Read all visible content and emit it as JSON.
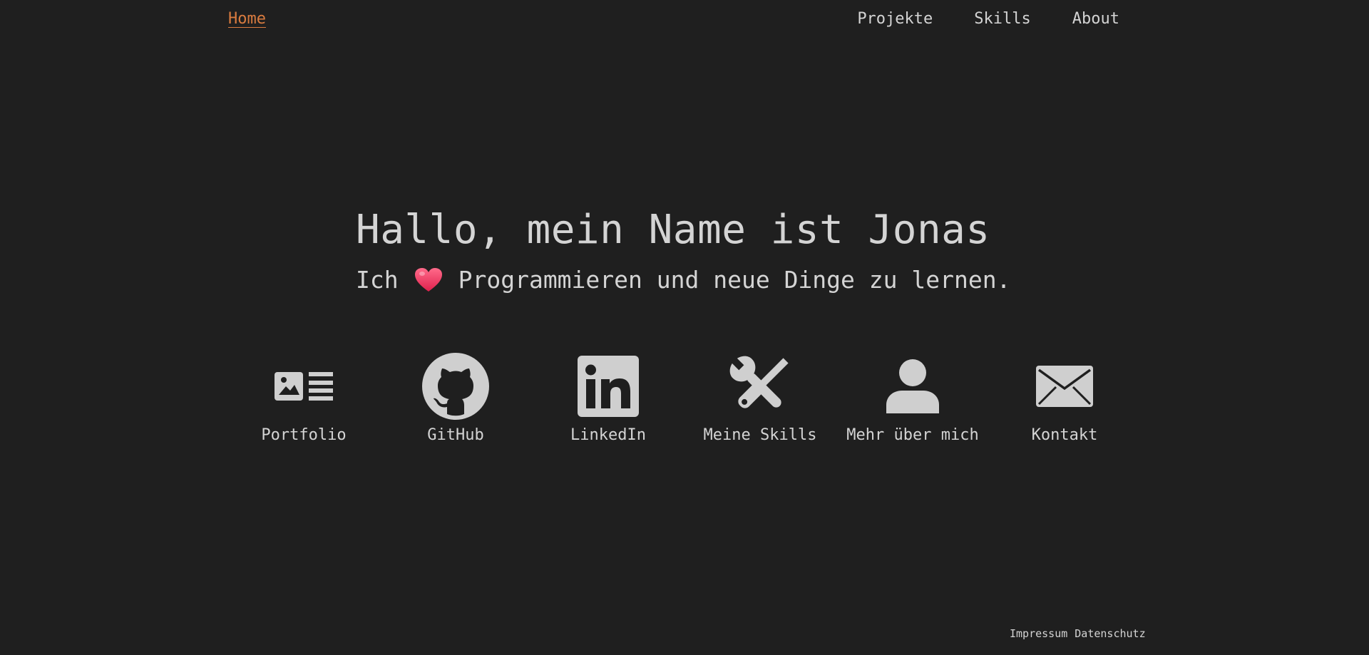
{
  "nav": {
    "home_label": "Home",
    "items": [
      {
        "label": "Projekte"
      },
      {
        "label": "Skills"
      },
      {
        "label": "About"
      }
    ]
  },
  "hero": {
    "title": "Hallo, mein Name ist Jonas",
    "sub_prefix": "Ich",
    "sub_suffix": "Programmieren und neue Dinge zu lernen."
  },
  "links": [
    {
      "label": "Portfolio",
      "icon": "portfolio-icon"
    },
    {
      "label": "GitHub",
      "icon": "github-icon"
    },
    {
      "label": "LinkedIn",
      "icon": "linkedin-icon"
    },
    {
      "label": "Meine Skills",
      "icon": "tools-icon"
    },
    {
      "label": "Mehr über mich",
      "icon": "user-icon"
    },
    {
      "label": "Kontakt",
      "icon": "envelope-icon"
    }
  ],
  "footer": {
    "impressum": "Impressum",
    "datenschutz": "Datenschutz"
  },
  "colors": {
    "background": "#1f1f1f",
    "text": "#d4d4d4",
    "accent": "#d97b3f",
    "heart": "#e8365f"
  }
}
